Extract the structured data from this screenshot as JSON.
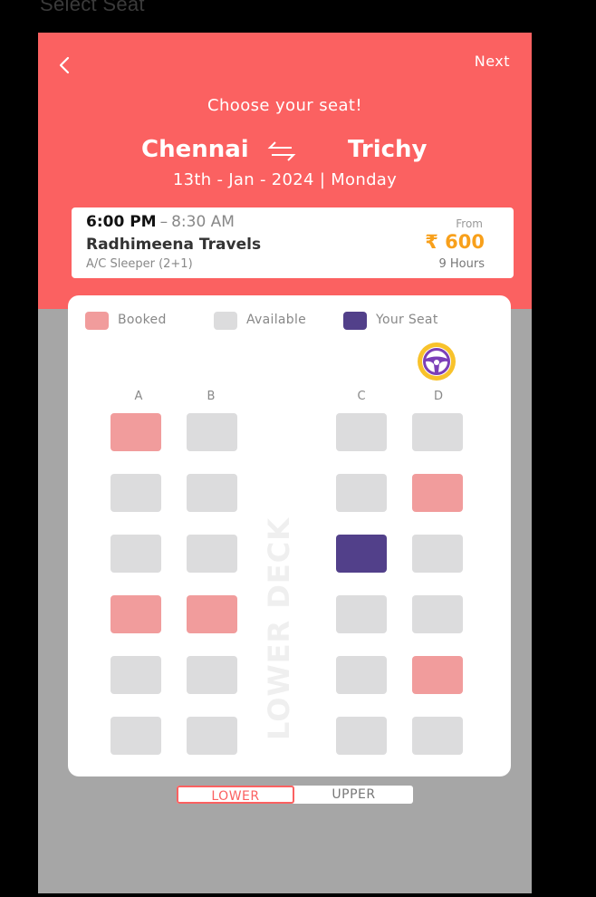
{
  "window": {
    "title": "Select Seat"
  },
  "header": {
    "next_label": "Next",
    "title": "Choose your seat!",
    "origin": "Chennai",
    "destination": "Trichy",
    "date_line": "13th - Jan - 2024 | Monday"
  },
  "trip": {
    "departure": "6:00 PM",
    "separator": "–",
    "arrival": "8:30 AM",
    "operator": "Radhimeena Travels",
    "bus_type": "A/C Sleeper (2+1)",
    "from_label": "From",
    "price": "₹ 600",
    "duration": "9 Hours"
  },
  "legend": [
    {
      "label": "Booked",
      "color": "#f19c9c"
    },
    {
      "label": "Available",
      "color": "#dcdcdd"
    },
    {
      "label": "Your Seat",
      "color": "#52408a"
    }
  ],
  "columns": [
    "A",
    "B",
    "C",
    "D"
  ],
  "seat_rows": [
    [
      "booked",
      "available",
      "available",
      "available"
    ],
    [
      "available",
      "available",
      "available",
      "booked"
    ],
    [
      "available",
      "available",
      "selected",
      "available"
    ],
    [
      "booked",
      "booked",
      "available",
      "available"
    ],
    [
      "available",
      "available",
      "available",
      "booked"
    ],
    [
      "available",
      "available",
      "available",
      "available"
    ]
  ],
  "deck_label": "LOWER DECK",
  "deck_toggle": {
    "lower": "LOWER",
    "upper": "UPPER",
    "active": "lower"
  },
  "colors": {
    "accent": "#fb6161",
    "booked": "#f19c9c",
    "available": "#dcdcdd",
    "selected": "#52408a",
    "price": "#f8a01b"
  },
  "icons": {
    "back": "chevron-left-icon",
    "swap": "swap-arrows-icon",
    "driver": "steering-wheel-icon"
  }
}
